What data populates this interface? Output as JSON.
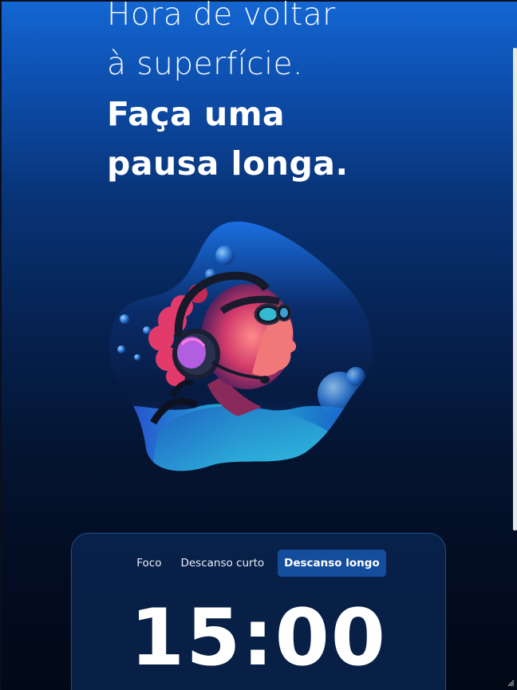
{
  "headline": {
    "line1": "Hora de voltar",
    "line2": "à superfície.",
    "line3": "Faça uma",
    "line4": "pausa longa."
  },
  "illustration": {
    "alt": "diver-with-headphones"
  },
  "timer": {
    "tabs": [
      {
        "label": "Foco",
        "active": false
      },
      {
        "label": "Descanso curto",
        "active": false
      },
      {
        "label": "Descanso longo",
        "active": true
      }
    ],
    "time": "15:00"
  },
  "colors": {
    "background_top": "#1467d3",
    "background_bottom": "#020916",
    "card_bg": "#0a2652",
    "card_border": "#1f4f92",
    "active_tab": "#144d9c",
    "accent_cyan": "#35d6e6",
    "accent_pink": "#ff4f7a"
  }
}
